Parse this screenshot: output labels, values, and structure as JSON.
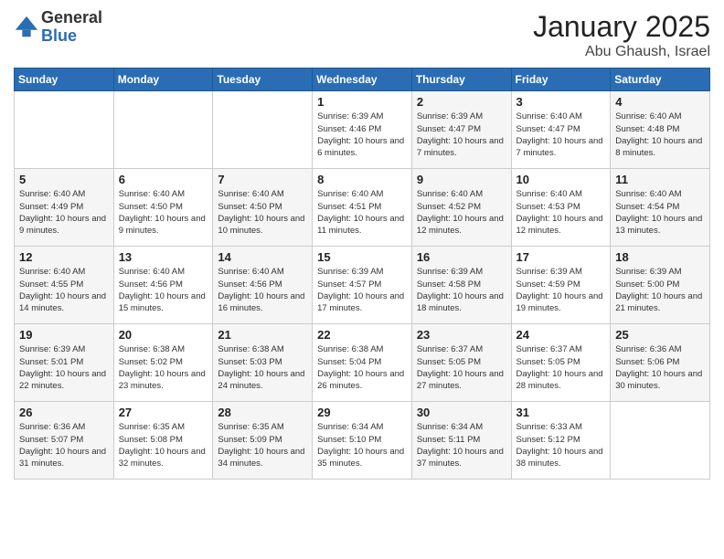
{
  "logo": {
    "general": "General",
    "blue": "Blue"
  },
  "header": {
    "title": "January 2025",
    "subtitle": "Abu Ghaush, Israel"
  },
  "weekdays": [
    "Sunday",
    "Monday",
    "Tuesday",
    "Wednesday",
    "Thursday",
    "Friday",
    "Saturday"
  ],
  "weeks": [
    [
      {
        "day": "",
        "info": ""
      },
      {
        "day": "",
        "info": ""
      },
      {
        "day": "",
        "info": ""
      },
      {
        "day": "1",
        "info": "Sunrise: 6:39 AM\nSunset: 4:46 PM\nDaylight: 10 hours\nand 6 minutes."
      },
      {
        "day": "2",
        "info": "Sunrise: 6:39 AM\nSunset: 4:47 PM\nDaylight: 10 hours\nand 7 minutes."
      },
      {
        "day": "3",
        "info": "Sunrise: 6:40 AM\nSunset: 4:47 PM\nDaylight: 10 hours\nand 7 minutes."
      },
      {
        "day": "4",
        "info": "Sunrise: 6:40 AM\nSunset: 4:48 PM\nDaylight: 10 hours\nand 8 minutes."
      }
    ],
    [
      {
        "day": "5",
        "info": "Sunrise: 6:40 AM\nSunset: 4:49 PM\nDaylight: 10 hours\nand 9 minutes."
      },
      {
        "day": "6",
        "info": "Sunrise: 6:40 AM\nSunset: 4:50 PM\nDaylight: 10 hours\nand 9 minutes."
      },
      {
        "day": "7",
        "info": "Sunrise: 6:40 AM\nSunset: 4:50 PM\nDaylight: 10 hours\nand 10 minutes."
      },
      {
        "day": "8",
        "info": "Sunrise: 6:40 AM\nSunset: 4:51 PM\nDaylight: 10 hours\nand 11 minutes."
      },
      {
        "day": "9",
        "info": "Sunrise: 6:40 AM\nSunset: 4:52 PM\nDaylight: 10 hours\nand 12 minutes."
      },
      {
        "day": "10",
        "info": "Sunrise: 6:40 AM\nSunset: 4:53 PM\nDaylight: 10 hours\nand 12 minutes."
      },
      {
        "day": "11",
        "info": "Sunrise: 6:40 AM\nSunset: 4:54 PM\nDaylight: 10 hours\nand 13 minutes."
      }
    ],
    [
      {
        "day": "12",
        "info": "Sunrise: 6:40 AM\nSunset: 4:55 PM\nDaylight: 10 hours\nand 14 minutes."
      },
      {
        "day": "13",
        "info": "Sunrise: 6:40 AM\nSunset: 4:56 PM\nDaylight: 10 hours\nand 15 minutes."
      },
      {
        "day": "14",
        "info": "Sunrise: 6:40 AM\nSunset: 4:56 PM\nDaylight: 10 hours\nand 16 minutes."
      },
      {
        "day": "15",
        "info": "Sunrise: 6:39 AM\nSunset: 4:57 PM\nDaylight: 10 hours\nand 17 minutes."
      },
      {
        "day": "16",
        "info": "Sunrise: 6:39 AM\nSunset: 4:58 PM\nDaylight: 10 hours\nand 18 minutes."
      },
      {
        "day": "17",
        "info": "Sunrise: 6:39 AM\nSunset: 4:59 PM\nDaylight: 10 hours\nand 19 minutes."
      },
      {
        "day": "18",
        "info": "Sunrise: 6:39 AM\nSunset: 5:00 PM\nDaylight: 10 hours\nand 21 minutes."
      }
    ],
    [
      {
        "day": "19",
        "info": "Sunrise: 6:39 AM\nSunset: 5:01 PM\nDaylight: 10 hours\nand 22 minutes."
      },
      {
        "day": "20",
        "info": "Sunrise: 6:38 AM\nSunset: 5:02 PM\nDaylight: 10 hours\nand 23 minutes."
      },
      {
        "day": "21",
        "info": "Sunrise: 6:38 AM\nSunset: 5:03 PM\nDaylight: 10 hours\nand 24 minutes."
      },
      {
        "day": "22",
        "info": "Sunrise: 6:38 AM\nSunset: 5:04 PM\nDaylight: 10 hours\nand 26 minutes."
      },
      {
        "day": "23",
        "info": "Sunrise: 6:37 AM\nSunset: 5:05 PM\nDaylight: 10 hours\nand 27 minutes."
      },
      {
        "day": "24",
        "info": "Sunrise: 6:37 AM\nSunset: 5:05 PM\nDaylight: 10 hours\nand 28 minutes."
      },
      {
        "day": "25",
        "info": "Sunrise: 6:36 AM\nSunset: 5:06 PM\nDaylight: 10 hours\nand 30 minutes."
      }
    ],
    [
      {
        "day": "26",
        "info": "Sunrise: 6:36 AM\nSunset: 5:07 PM\nDaylight: 10 hours\nand 31 minutes."
      },
      {
        "day": "27",
        "info": "Sunrise: 6:35 AM\nSunset: 5:08 PM\nDaylight: 10 hours\nand 32 minutes."
      },
      {
        "day": "28",
        "info": "Sunrise: 6:35 AM\nSunset: 5:09 PM\nDaylight: 10 hours\nand 34 minutes."
      },
      {
        "day": "29",
        "info": "Sunrise: 6:34 AM\nSunset: 5:10 PM\nDaylight: 10 hours\nand 35 minutes."
      },
      {
        "day": "30",
        "info": "Sunrise: 6:34 AM\nSunset: 5:11 PM\nDaylight: 10 hours\nand 37 minutes."
      },
      {
        "day": "31",
        "info": "Sunrise: 6:33 AM\nSunset: 5:12 PM\nDaylight: 10 hours\nand 38 minutes."
      },
      {
        "day": "",
        "info": ""
      }
    ]
  ]
}
